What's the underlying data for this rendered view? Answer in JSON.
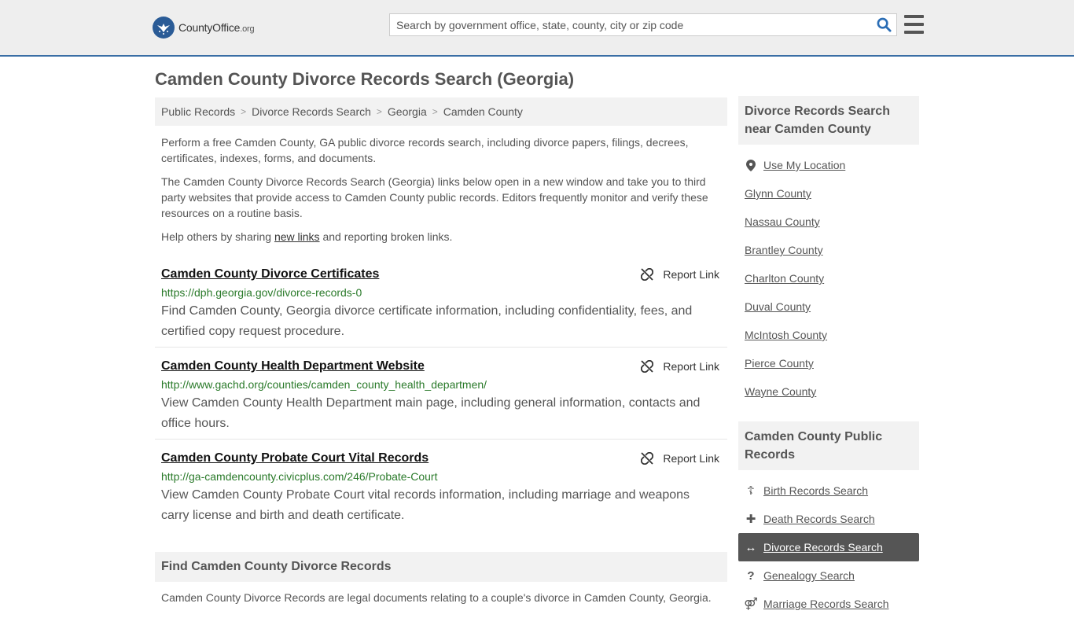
{
  "header": {
    "logo_name": "CountyOffice",
    "logo_tld": ".org",
    "search_placeholder": "Search by government office, state, county, city or zip code"
  },
  "page_title": "Camden County Divorce Records Search (Georgia)",
  "breadcrumb": [
    "Public Records",
    "Divorce Records Search",
    "Georgia",
    "Camden County"
  ],
  "intro": {
    "p1": "Perform a free Camden County, GA public divorce records search, including divorce papers, filings, decrees, certificates, indexes, forms, and documents.",
    "p2": "The Camden County Divorce Records Search (Georgia) links below open in a new window and take you to third party websites that provide access to Camden County public records. Editors frequently monitor and verify these resources on a routine basis.",
    "p3_before": "Help others by sharing ",
    "p3_link": "new links",
    "p3_after": " and reporting broken links."
  },
  "results": [
    {
      "title": "Camden County Divorce Certificates",
      "url": "https://dph.georgia.gov/divorce-records-0",
      "desc": "Find Camden County, Georgia divorce certificate information, including confidentiality, fees, and certified copy request procedure.",
      "report": "Report Link"
    },
    {
      "title": "Camden County Health Department Website",
      "url": "http://www.gachd.org/counties/camden_county_health_departmen/",
      "desc": "View Camden County Health Department main page, including general information, contacts and office hours.",
      "report": "Report Link"
    },
    {
      "title": "Camden County Probate Court Vital Records",
      "url": "http://ga-camdencounty.civicplus.com/246/Probate-Court",
      "desc": "View Camden County Probate Court vital records information, including marriage and weapons carry license and birth and death certificate.",
      "report": "Report Link"
    }
  ],
  "find": {
    "header": "Find Camden County Divorce Records",
    "text": "Camden County Divorce Records are legal documents relating to a couple's divorce in Camden County, Georgia."
  },
  "sidebar": {
    "nearby_header": "Divorce Records Search near Camden County",
    "use_location": "Use My Location",
    "nearby": [
      "Glynn County",
      "Nassau County",
      "Brantley County",
      "Charlton County",
      "Duval County",
      "McIntosh County",
      "Pierce County",
      "Wayne County"
    ],
    "public_header": "Camden County Public Records",
    "public": [
      {
        "label": "Birth Records Search",
        "icon": "baby-icon",
        "glyph": "☦"
      },
      {
        "label": "Death Records Search",
        "icon": "cross-icon",
        "glyph": "✚"
      },
      {
        "label": "Divorce Records Search",
        "icon": "split-arrows-icon",
        "glyph": "↔"
      },
      {
        "label": "Genealogy Search",
        "icon": "question-icon",
        "glyph": "?"
      },
      {
        "label": "Marriage Records Search",
        "icon": "gender-icon",
        "glyph": "⚤"
      }
    ]
  },
  "colors": {
    "accent": "#3a6ea5",
    "url_green": "#2a7a2a",
    "active_bg": "#555555",
    "search_icon": "#2a6db5"
  }
}
